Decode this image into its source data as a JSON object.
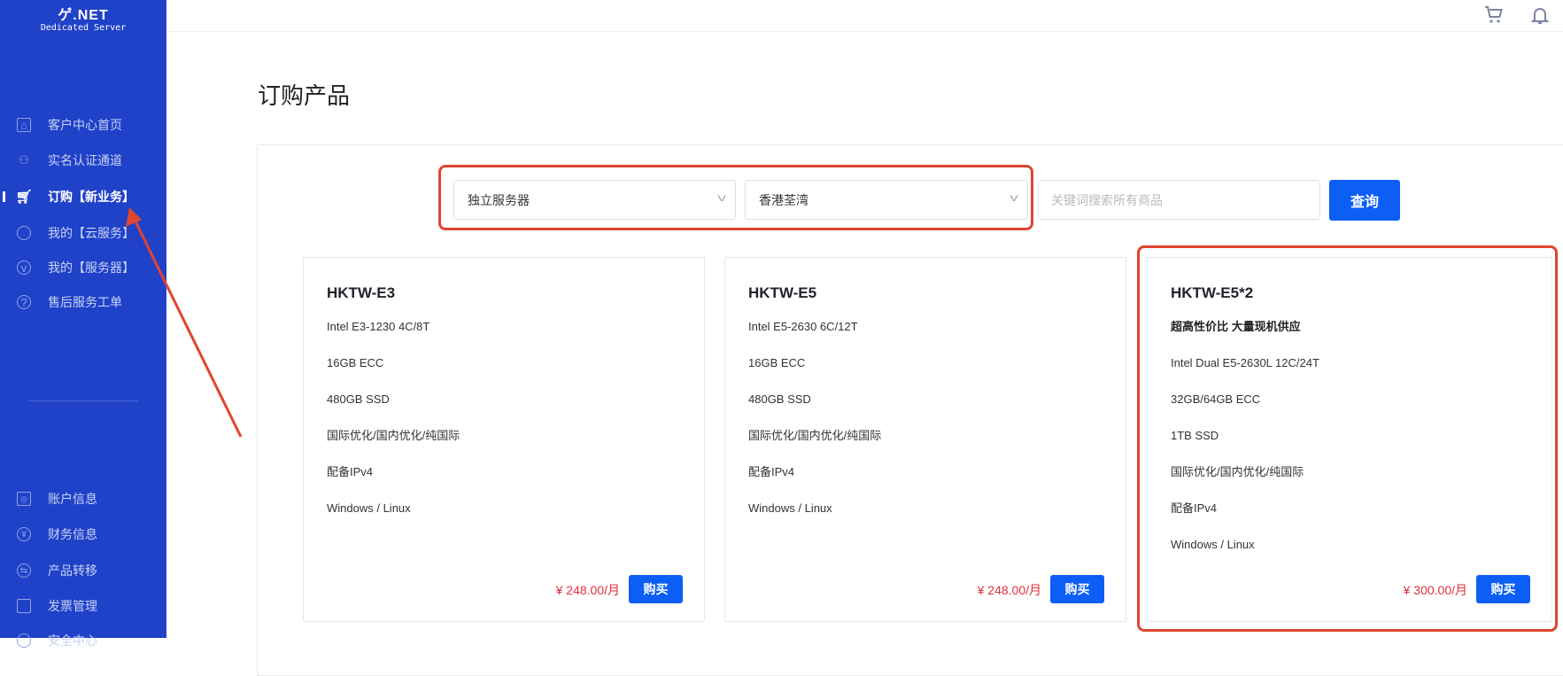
{
  "brand": {
    "logo_text": "ゲ.NET",
    "subtitle": "Dedicated Server"
  },
  "sidebar": {
    "items": [
      {
        "label": "客户中心首页",
        "icon": "home-icon"
      },
      {
        "label": "实名认证通道",
        "icon": "user-icon"
      },
      {
        "label": "订购【新业务】",
        "icon": "cart-icon",
        "active": true
      },
      {
        "label": "我的【云服务】",
        "icon": "pie-icon"
      },
      {
        "label": "我的【服务器】",
        "icon": "server-icon"
      },
      {
        "label": "售后服务工单",
        "icon": "help-icon"
      }
    ],
    "bottom_items": [
      {
        "label": "账户信息",
        "icon": "account-icon"
      },
      {
        "label": "财务信息",
        "icon": "yen-icon"
      },
      {
        "label": "产品转移",
        "icon": "transfer-icon"
      },
      {
        "label": "发票管理",
        "icon": "invoice-icon"
      },
      {
        "label": "安全中心",
        "icon": "security-icon"
      }
    ]
  },
  "header": {
    "icons": [
      "cart-icon",
      "bell-icon"
    ]
  },
  "page": {
    "title": "订购产品"
  },
  "filters": {
    "category": "独立服务器",
    "region": "香港荃湾",
    "search_placeholder": "关键词搜索所有商品",
    "search_value": "",
    "query_label": "查询"
  },
  "products": [
    {
      "name": "HKTW-E3",
      "lines": [
        "Intel E3-1230 4C/8T",
        "16GB ECC",
        "480GB SSD",
        "国际优化/国内优化/纯国际",
        "配备IPv4",
        "Windows / Linux"
      ],
      "price": "¥ 248.00/月",
      "buy": "购买"
    },
    {
      "name": "HKTW-E5",
      "lines": [
        "Intel E5-2630 6C/12T",
        "16GB ECC",
        "480GB SSD",
        "国际优化/国内优化/纯国际",
        "配备IPv4",
        "Windows / Linux"
      ],
      "price": "¥ 248.00/月",
      "buy": "购买"
    },
    {
      "name": "HKTW-E5*2",
      "tagline": "超高性价比 大量现机供应",
      "lines": [
        "Intel Dual E5-2630L 12C/24T",
        "32GB/64GB ECC",
        "1TB SSD",
        "国际优化/国内优化/纯国际",
        "配备IPv4",
        "Windows / Linux"
      ],
      "price": "¥ 300.00/月",
      "buy": "购买"
    }
  ],
  "colors": {
    "sidebar": "#2042c9",
    "primary": "#0d5ef5",
    "price": "#e0303d",
    "annotation": "#e0452f"
  }
}
